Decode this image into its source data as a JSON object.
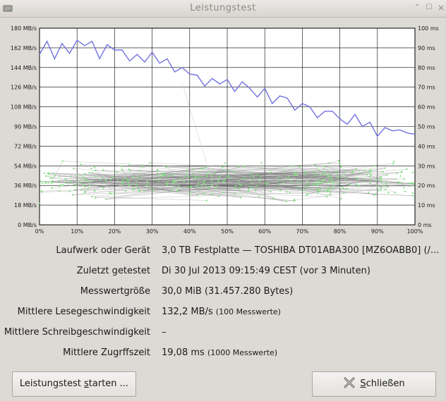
{
  "window": {
    "title": "Leistungstest"
  },
  "chart_data": {
    "type": "line",
    "title": "",
    "xlabel": "",
    "ylabel": "",
    "y2label": "",
    "x_ticks": [
      "0%",
      "10%",
      "20%",
      "30%",
      "40%",
      "50%",
      "60%",
      "70%",
      "80%",
      "90%",
      "100%"
    ],
    "y_left_ticks": [
      "0 MB/s",
      "18 MB/s",
      "36 MB/s",
      "54 MB/s",
      "72 MB/s",
      "90 MB/s",
      "108 MB/s",
      "126 MB/s",
      "144 MB/s",
      "162 MB/s",
      "180 MB/s"
    ],
    "y_right_ticks": [
      "0 ms",
      "10 ms",
      "20 ms",
      "30 ms",
      "40 ms",
      "50 ms",
      "60 ms",
      "70 ms",
      "80 ms",
      "90 ms",
      "100 ms"
    ],
    "xlim": [
      0,
      100
    ],
    "ylim_left": [
      0,
      180
    ],
    "ylim_right": [
      0,
      100
    ],
    "grid": true,
    "colors": {
      "read": "#7272e0",
      "access_points": "#7ee07e",
      "access_lines": "#6f6f6f"
    },
    "series": [
      {
        "axis": "left",
        "x": [
          0,
          2,
          4,
          6,
          8,
          10,
          12,
          14,
          16,
          18,
          20,
          22,
          24,
          26,
          28,
          30,
          32,
          34,
          36,
          38,
          40,
          42,
          44,
          46,
          48,
          50,
          52,
          54,
          56,
          58,
          60,
          62,
          64,
          66,
          68,
          70,
          72,
          74,
          76,
          78,
          80,
          82,
          84,
          86,
          88,
          90,
          92,
          94,
          96,
          98,
          100
        ],
        "values": [
          156,
          168,
          152,
          166,
          157,
          169,
          164,
          168,
          152,
          165,
          160,
          160,
          150,
          156,
          149,
          158,
          148,
          152,
          140,
          144,
          138,
          137,
          127,
          134,
          129,
          133,
          122,
          131,
          125,
          117,
          125,
          111,
          118,
          116,
          105,
          111,
          108,
          98,
          104,
          104,
          97,
          92,
          101,
          90,
          94,
          81,
          89,
          86,
          87,
          84,
          83
        ]
      }
    ],
    "access_time_note": "1000 scattered access-time samples (~10–35 ms range) with connecting lines"
  },
  "info": {
    "device": {
      "label": "Laufwerk oder Gerät",
      "value": "3,0 TB Festplatte — TOSHIBA DT01ABA300 [MZ6OABB0] (/..."
    },
    "last": {
      "label": "Zuletzt getestet",
      "value": "Di 30 Jul 2013 09:15:49 CEST (vor 3 Minuten)"
    },
    "size": {
      "label": "Messwertgröße",
      "value": "30,0 MiB (31.457.280 Bytes)"
    },
    "read": {
      "label": "Mittlere Lesegeschwindigkeit",
      "value": "132,2 MB/s",
      "note": "(100 Messwerte)"
    },
    "write": {
      "label": "Mittlere Schreibgeschwindigkeit",
      "value": "–"
    },
    "access": {
      "label": "Mittlere Zugrffszeit",
      "value": "19,08 ms",
      "note": "(1000 Messwerte)"
    }
  },
  "buttons": {
    "start": {
      "before": "Leistungstest ",
      "mnemonic": "s",
      "after": "tarten ..."
    },
    "close": {
      "before": "",
      "mnemonic": "S",
      "after": "chließen"
    }
  }
}
